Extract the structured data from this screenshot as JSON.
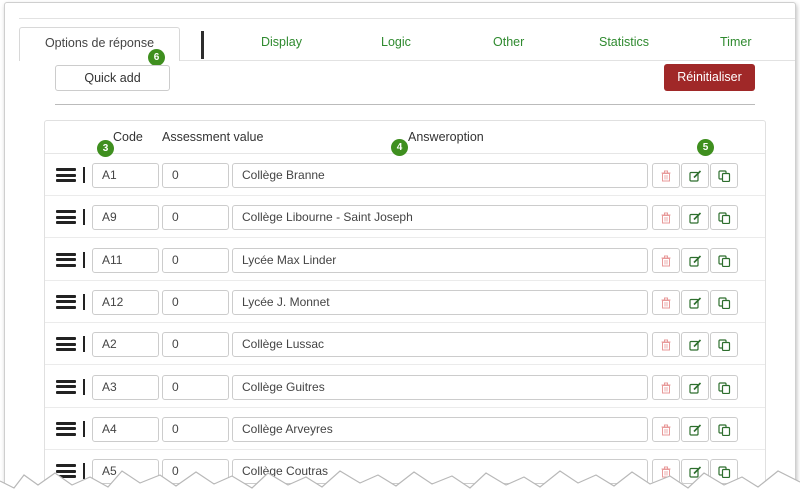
{
  "tabs": {
    "active": "Options de réponse",
    "others": [
      "Display",
      "Logic",
      "Other",
      "Statistics",
      "Timer"
    ]
  },
  "toolbar": {
    "quick_add": "Quick add",
    "reset": "Réinitialiser"
  },
  "table": {
    "headers": {
      "code": "Code",
      "assessment": "Assessment value",
      "answer": "Answeroption"
    },
    "rows": [
      {
        "code": "A1",
        "assessment": "0",
        "answer": "Collège Branne"
      },
      {
        "code": "A9",
        "assessment": "0",
        "answer": "Collège Libourne - Saint Joseph"
      },
      {
        "code": "A11",
        "assessment": "0",
        "answer": "Lycée Max Linder"
      },
      {
        "code": "A12",
        "assessment": "0",
        "answer": "Lycée J. Monnet"
      },
      {
        "code": "A2",
        "assessment": "0",
        "answer": "Collège Lussac"
      },
      {
        "code": "A3",
        "assessment": "0",
        "answer": "Collège Guitres"
      },
      {
        "code": "A4",
        "assessment": "0",
        "answer": "Collège Arveyres"
      },
      {
        "code": "A5",
        "assessment": "0",
        "answer": "Collège Coutras"
      }
    ]
  },
  "badges": {
    "tab_badge": "6",
    "code_badge": "3",
    "answer_badge": "4",
    "actions_badge": "5"
  },
  "colors": {
    "tab_link": "#2f8a2f",
    "reset_button": "#a02828",
    "badge": "#3f8f1f",
    "delete_icon": "#e89a9a",
    "action_icon": "#2d6e2d"
  },
  "icons": {
    "drag": "drag-handle-icon",
    "delete": "trash-icon",
    "edit": "edit-icon",
    "copy": "copy-icon"
  }
}
